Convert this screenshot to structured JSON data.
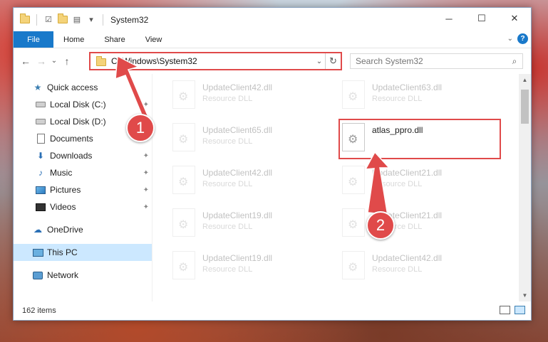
{
  "window": {
    "title": "System32",
    "controls": {
      "minimize": "─",
      "maximize": "☐",
      "close": "✕"
    }
  },
  "quick_access_icons": [
    "folder-icon",
    "properties-icon",
    "new-folder-icon",
    "customize-icon"
  ],
  "ribbon": {
    "tabs": [
      "File",
      "Home",
      "Share",
      "View"
    ],
    "help": "?",
    "expand": "⌄"
  },
  "navigation": {
    "back": "←",
    "forward": "→",
    "recent": "⌄",
    "up": "↑",
    "address": "C:\\Windows\\System32",
    "address_dropdown": "⌄",
    "refresh": "↻",
    "search_placeholder": "Search System32",
    "search_glyph": "⌕"
  },
  "nav_pane": {
    "items": [
      {
        "label": "Quick access",
        "icon": "star-icon",
        "glyph": "★",
        "pinned": false
      },
      {
        "label": "Local Disk (C:)",
        "icon": "drive-icon",
        "pinned": true
      },
      {
        "label": "Local Disk (D:)",
        "icon": "drive-icon",
        "pinned": false
      },
      {
        "label": "Documents",
        "icon": "documents-icon",
        "pinned": false
      },
      {
        "label": "Downloads",
        "icon": "downloads-icon",
        "glyph": "⬇",
        "pinned": true
      },
      {
        "label": "Music",
        "icon": "music-icon",
        "glyph": "♪",
        "pinned": true
      },
      {
        "label": "Pictures",
        "icon": "pictures-icon",
        "pinned": true
      },
      {
        "label": "Videos",
        "icon": "videos-icon",
        "pinned": true
      },
      {
        "label": "OneDrive",
        "icon": "onedrive-icon",
        "glyph": "☁",
        "pinned": false
      },
      {
        "label": "This PC",
        "icon": "pc-icon",
        "pinned": false,
        "selected": true
      },
      {
        "label": "Network",
        "icon": "network-icon",
        "pinned": false
      }
    ],
    "pin_glyph": "📌"
  },
  "files": [
    {
      "name": "UpdateClient42.dll",
      "type": "Resource DLL",
      "faded": true
    },
    {
      "name": "UpdateClient63.dll",
      "type": "Resource DLL",
      "faded": true
    },
    {
      "name": "UpdateClient65.dll",
      "type": "Resource DLL",
      "faded": true
    },
    {
      "name": "atlas_ppro.dll",
      "type": "",
      "faded": false
    },
    {
      "name": "UpdateClient42.dll",
      "type": "Resource DLL",
      "faded": true
    },
    {
      "name": "UpdateClient21.dll",
      "type": "Resource DLL",
      "faded": true
    },
    {
      "name": "UpdateClient19.dll",
      "type": "Resource DLL",
      "faded": true
    },
    {
      "name": "UpdateClient21.dll",
      "type": "Resource DLL",
      "faded": true
    },
    {
      "name": "UpdateClient19.dll",
      "type": "Resource DLL",
      "faded": true
    },
    {
      "name": "UpdateClient42.dll",
      "type": "Resource DLL",
      "faded": true
    }
  ],
  "status": {
    "item_count": "162 items"
  },
  "annotations": {
    "step1": "1",
    "step2": "2",
    "color": "#e04a4a"
  }
}
